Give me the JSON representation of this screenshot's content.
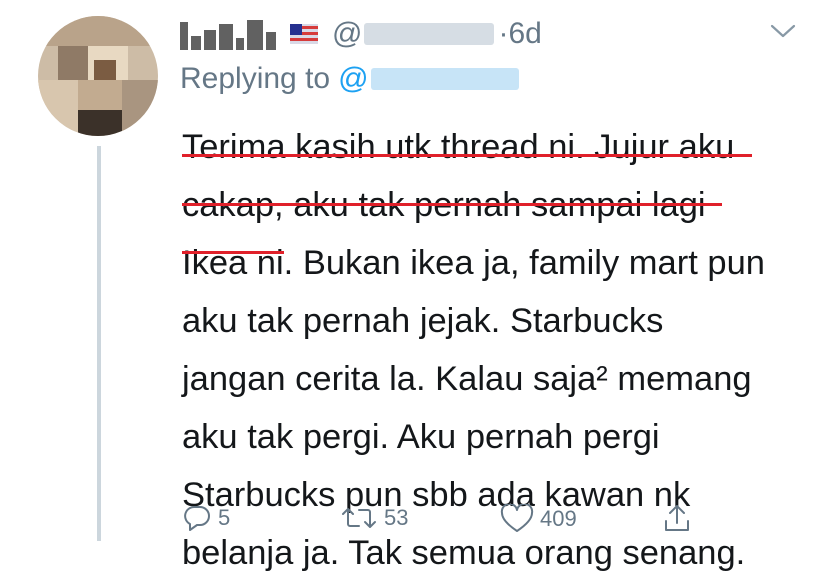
{
  "tweet": {
    "time_sep": "·",
    "timestamp": "6d",
    "handle_prefix": "@",
    "replying_to_label": "Replying to",
    "replying_at": "@",
    "lines": [
      "Terima kasih utk thread ni. Jujur aku",
      "cakap, aku tak pernah sampai lagi",
      "Ikea ni. Bukan ikea ja, family mart pun",
      "aku tak pernah jejak. Starbucks",
      "jangan cerita la. Kalau saja² memang",
      "aku tak pergi. Aku pernah pergi",
      "Starbucks pun sbb ada kawan nk",
      "belanja ja. Tak semua orang senang."
    ]
  },
  "actions": {
    "reply_count": "5",
    "retweet_count": "53",
    "like_count": "409"
  },
  "colors": {
    "secondary_text": "#657786",
    "link_blue": "#1da1f2",
    "underline_red": "#e0202a",
    "thread_line": "#ccd6dd"
  },
  "icons": [
    "reply-icon",
    "retweet-icon",
    "like-icon",
    "share-icon",
    "chevron-down-icon"
  ]
}
